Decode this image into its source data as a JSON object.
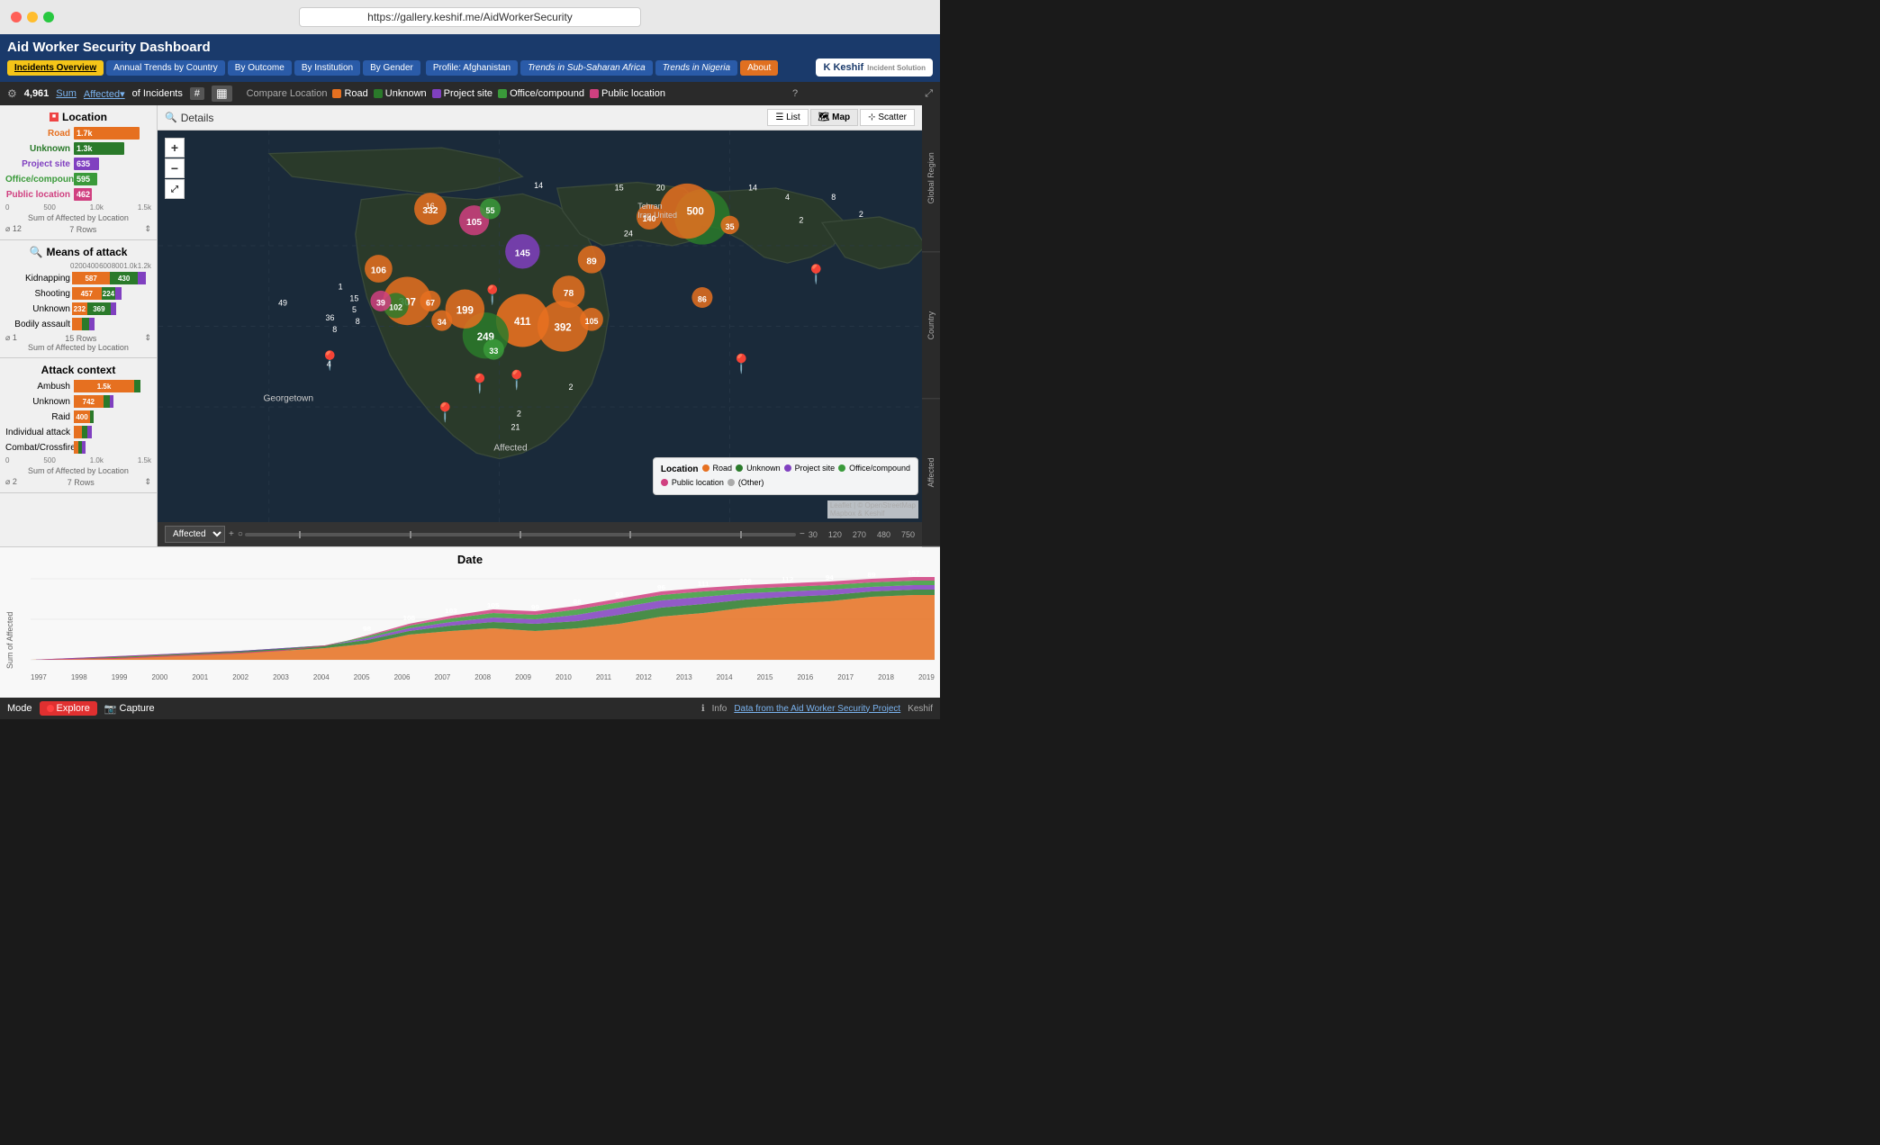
{
  "titlebar": {
    "url": "https://gallery.keshif.me/AidWorkerSecurity"
  },
  "navbar": {
    "title": "Aid Worker Security Dashboard",
    "tabs": [
      {
        "label": "Incidents Overview",
        "active": true,
        "style": "active"
      },
      {
        "label": "Annual Trends by Country",
        "style": "normal"
      },
      {
        "label": "By Outcome",
        "style": "normal"
      },
      {
        "label": "By Institution",
        "style": "normal"
      },
      {
        "label": "By Gender",
        "style": "normal"
      },
      {
        "label": "Profile: Afghanistan",
        "style": "normal"
      },
      {
        "label": "Trends in Sub-Saharan Africa",
        "style": "italic"
      },
      {
        "label": "Trends in Nigeria",
        "style": "italic"
      },
      {
        "label": "About",
        "style": "orange"
      }
    ],
    "logo_text": "K Keshif",
    "logo_sub": "Incident Solution"
  },
  "filterbar": {
    "total": "4,961",
    "metric": "Sum",
    "dimension": "Affected",
    "of": "of Incidents",
    "compare_label": "Compare Location",
    "legend": [
      {
        "label": "Road",
        "color": "#e67020"
      },
      {
        "label": "Unknown",
        "color": "#2a7a2a"
      },
      {
        "label": "Project site",
        "color": "#8040c0"
      },
      {
        "label": "Office/compound",
        "color": "#3a9a3a"
      },
      {
        "label": "Public location",
        "color": "#d04080"
      }
    ]
  },
  "location_panel": {
    "title": "Location",
    "rows": [
      {
        "label": "Road",
        "value": "1.7k",
        "pct": 85,
        "style": "road"
      },
      {
        "label": "Unknown",
        "value": "1.3k",
        "pct": 65,
        "style": "unknown"
      },
      {
        "label": "Project site",
        "value": "635",
        "pct": 32,
        "style": "project"
      },
      {
        "label": "Office/compound",
        "value": "595",
        "pct": 30,
        "style": "office"
      },
      {
        "label": "Public location",
        "value": "462",
        "pct": 23,
        "style": "public"
      }
    ],
    "axis_labels": [
      "0",
      "500",
      "1.0k",
      "1.5k"
    ],
    "axis_title": "Sum of Affected by Location",
    "row_count": "7 Rows",
    "avg": "12"
  },
  "means_panel": {
    "title": "Means of attack",
    "rows": [
      {
        "label": "Kidnapping",
        "segs": [
          {
            "val": "587",
            "pct": 48,
            "style": "seg-orange"
          },
          {
            "val": "430",
            "pct": 35,
            "style": "seg-green"
          },
          {
            "pct": 10,
            "style": "seg-purple"
          }
        ]
      },
      {
        "label": "Shooting",
        "segs": [
          {
            "val": "457",
            "pct": 37,
            "style": "seg-orange"
          },
          {
            "val": "224",
            "pct": 18,
            "style": "seg-green"
          },
          {
            "pct": 8,
            "style": "seg-purple"
          }
        ]
      },
      {
        "label": "Unknown",
        "segs": [
          {
            "val": "232",
            "pct": 19,
            "style": "seg-orange"
          },
          {
            "val": "369",
            "pct": 30,
            "style": "seg-green"
          },
          {
            "pct": 7,
            "style": "seg-purple"
          }
        ]
      },
      {
        "label": "Bodily assault",
        "segs": [
          {
            "pct": 12,
            "style": "seg-orange"
          },
          {
            "pct": 10,
            "style": "seg-green"
          },
          {
            "pct": 6,
            "style": "seg-purple"
          }
        ]
      }
    ],
    "axis_labels": [
      "0",
      "200",
      "400",
      "600",
      "800",
      "1.0k",
      "1.2k"
    ],
    "axis_title": "Sum of Affected by Location",
    "row_count": "15 Rows",
    "avg": "1"
  },
  "context_panel": {
    "title": "Attack context",
    "rows": [
      {
        "label": "Ambush",
        "value": "1.5k",
        "pct": 78,
        "has_right": true
      },
      {
        "label": "Unknown",
        "value": "742",
        "pct": 38,
        "has_right": true
      },
      {
        "label": "Raid",
        "value": "400",
        "pct": 21,
        "has_right": false
      },
      {
        "label": "Individual attack",
        "segs": true
      },
      {
        "label": "Combat/Crossfire",
        "segs": true
      }
    ],
    "axis_labels": [
      "0",
      "500",
      "1.0k",
      "1.5k"
    ],
    "axis_title": "Sum of Affected by Location",
    "row_count": "7 Rows",
    "avg": "2"
  },
  "map": {
    "details_label": "Details",
    "view_buttons": [
      "List",
      "Map",
      "Scatter"
    ],
    "active_view": "Map",
    "attribution": "Leaflet | © OpenStreetMap Mapbox & Keshif",
    "markers": [
      {
        "x": 47,
        "y": 22,
        "num": "55",
        "size": 28
      },
      {
        "x": 39,
        "y": 25,
        "num": "332",
        "size": 42
      },
      {
        "x": 43,
        "y": 24,
        "num": "145",
        "size": 34
      },
      {
        "x": 61,
        "y": 20,
        "num": "140",
        "size": 34
      },
      {
        "x": 66,
        "y": 22,
        "num": "500",
        "size": 48
      },
      {
        "x": 70,
        "y": 19,
        "num": "0",
        "size": 20
      },
      {
        "x": 71,
        "y": 20,
        "num": "35",
        "size": 26
      },
      {
        "x": 37,
        "y": 40,
        "num": "307",
        "size": 42
      },
      {
        "x": 33,
        "y": 44,
        "num": "106",
        "size": 32
      },
      {
        "x": 38,
        "y": 45,
        "num": "39",
        "size": 26
      },
      {
        "x": 40,
        "y": 46,
        "num": "67",
        "size": 28
      },
      {
        "x": 43,
        "y": 48,
        "num": "199",
        "size": 36
      },
      {
        "x": 44,
        "y": 50,
        "num": "34",
        "size": 24
      },
      {
        "x": 41,
        "y": 51,
        "num": "102",
        "size": 32
      },
      {
        "x": 44,
        "y": 55,
        "num": "411",
        "size": 46
      },
      {
        "x": 44,
        "y": 53,
        "num": "249",
        "size": 40
      },
      {
        "x": 46,
        "y": 50,
        "num": "392",
        "size": 44
      },
      {
        "x": 50,
        "y": 49,
        "num": "78",
        "size": 30
      },
      {
        "x": 52,
        "y": 52,
        "num": "105",
        "size": 32
      },
      {
        "x": 39,
        "y": 56,
        "num": "33",
        "size": 24
      },
      {
        "x": 56,
        "y": 42,
        "num": "89",
        "size": 30
      },
      {
        "x": 66,
        "y": 52,
        "num": "86",
        "size": 30
      },
      {
        "x": 77,
        "y": 42,
        "num": "2",
        "size": 16
      }
    ],
    "legend": {
      "title": "Location",
      "items": [
        {
          "label": "Road",
          "color": "#e67020"
        },
        {
          "label": "Unknown",
          "color": "#2a7a2a"
        },
        {
          "label": "Project site",
          "color": "#8040c0"
        },
        {
          "label": "Office/compound",
          "color": "#3a9a3a"
        },
        {
          "label": "Public location",
          "color": "#d04080"
        },
        {
          "label": "(Other)",
          "color": "#aaaaaa"
        }
      ]
    },
    "slider": {
      "metric": "Affected",
      "marks": [
        "30",
        "120",
        "270",
        "480",
        "750"
      ]
    }
  },
  "right_labels": [
    "Global Region",
    "Country",
    "Affected"
  ],
  "date_chart": {
    "title": "Date",
    "y_label": "Sum of Affected",
    "y_max": 400,
    "x_labels": [
      "1997",
      "1998",
      "1999",
      "2000",
      "2001",
      "2002",
      "2003",
      "2004",
      "2005",
      "2006",
      "2007",
      "2008",
      "2009",
      "2010",
      "2011",
      "2012",
      "2013",
      "2014",
      "2015",
      "2016",
      "2017",
      "2018",
      "2019"
    ],
    "annotations": [
      "98",
      "108",
      "103",
      "105",
      "99",
      "88",
      "93",
      "96",
      "111",
      "209",
      "112",
      "94",
      "89",
      "157"
    ],
    "annotation_years": [
      "2007",
      "2008",
      "2009",
      "2010",
      "2011",
      "2012",
      "2013",
      "2014",
      "2015",
      "2016",
      "2017",
      "2018",
      "2019",
      "2018"
    ]
  },
  "bottombar": {
    "mode_label": "Mode",
    "explore_label": "Explore",
    "capture_label": "Capture",
    "info_label": "Info",
    "data_credit": "Data from the Aid Worker Security Project",
    "keshif_label": "Keshif"
  },
  "other_texts": {
    "georgetown": "Georgetown",
    "affected_label": "Affected",
    "unknown_label": "Unknown",
    "public_location": "Public location",
    "tehran_iran": "Tehran Iran United"
  }
}
